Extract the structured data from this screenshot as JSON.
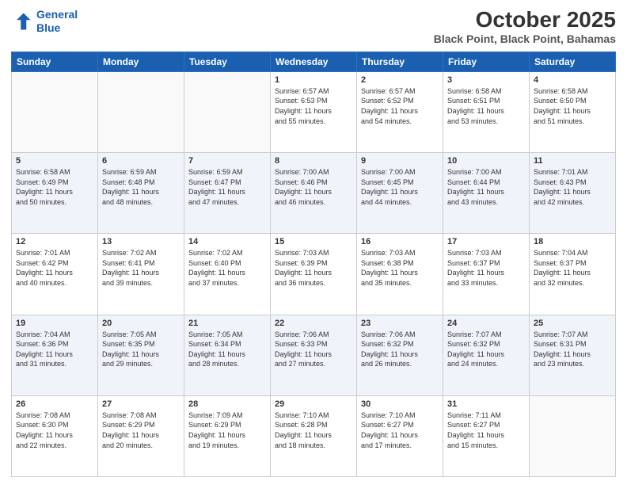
{
  "header": {
    "logo_line1": "General",
    "logo_line2": "Blue",
    "month": "October 2025",
    "location": "Black Point, Black Point, Bahamas"
  },
  "days_of_week": [
    "Sunday",
    "Monday",
    "Tuesday",
    "Wednesday",
    "Thursday",
    "Friday",
    "Saturday"
  ],
  "weeks": [
    [
      {
        "day": "",
        "info": ""
      },
      {
        "day": "",
        "info": ""
      },
      {
        "day": "",
        "info": ""
      },
      {
        "day": "1",
        "info": "Sunrise: 6:57 AM\nSunset: 6:53 PM\nDaylight: 11 hours\nand 55 minutes."
      },
      {
        "day": "2",
        "info": "Sunrise: 6:57 AM\nSunset: 6:52 PM\nDaylight: 11 hours\nand 54 minutes."
      },
      {
        "day": "3",
        "info": "Sunrise: 6:58 AM\nSunset: 6:51 PM\nDaylight: 11 hours\nand 53 minutes."
      },
      {
        "day": "4",
        "info": "Sunrise: 6:58 AM\nSunset: 6:50 PM\nDaylight: 11 hours\nand 51 minutes."
      }
    ],
    [
      {
        "day": "5",
        "info": "Sunrise: 6:58 AM\nSunset: 6:49 PM\nDaylight: 11 hours\nand 50 minutes."
      },
      {
        "day": "6",
        "info": "Sunrise: 6:59 AM\nSunset: 6:48 PM\nDaylight: 11 hours\nand 48 minutes."
      },
      {
        "day": "7",
        "info": "Sunrise: 6:59 AM\nSunset: 6:47 PM\nDaylight: 11 hours\nand 47 minutes."
      },
      {
        "day": "8",
        "info": "Sunrise: 7:00 AM\nSunset: 6:46 PM\nDaylight: 11 hours\nand 46 minutes."
      },
      {
        "day": "9",
        "info": "Sunrise: 7:00 AM\nSunset: 6:45 PM\nDaylight: 11 hours\nand 44 minutes."
      },
      {
        "day": "10",
        "info": "Sunrise: 7:00 AM\nSunset: 6:44 PM\nDaylight: 11 hours\nand 43 minutes."
      },
      {
        "day": "11",
        "info": "Sunrise: 7:01 AM\nSunset: 6:43 PM\nDaylight: 11 hours\nand 42 minutes."
      }
    ],
    [
      {
        "day": "12",
        "info": "Sunrise: 7:01 AM\nSunset: 6:42 PM\nDaylight: 11 hours\nand 40 minutes."
      },
      {
        "day": "13",
        "info": "Sunrise: 7:02 AM\nSunset: 6:41 PM\nDaylight: 11 hours\nand 39 minutes."
      },
      {
        "day": "14",
        "info": "Sunrise: 7:02 AM\nSunset: 6:40 PM\nDaylight: 11 hours\nand 37 minutes."
      },
      {
        "day": "15",
        "info": "Sunrise: 7:03 AM\nSunset: 6:39 PM\nDaylight: 11 hours\nand 36 minutes."
      },
      {
        "day": "16",
        "info": "Sunrise: 7:03 AM\nSunset: 6:38 PM\nDaylight: 11 hours\nand 35 minutes."
      },
      {
        "day": "17",
        "info": "Sunrise: 7:03 AM\nSunset: 6:37 PM\nDaylight: 11 hours\nand 33 minutes."
      },
      {
        "day": "18",
        "info": "Sunrise: 7:04 AM\nSunset: 6:37 PM\nDaylight: 11 hours\nand 32 minutes."
      }
    ],
    [
      {
        "day": "19",
        "info": "Sunrise: 7:04 AM\nSunset: 6:36 PM\nDaylight: 11 hours\nand 31 minutes."
      },
      {
        "day": "20",
        "info": "Sunrise: 7:05 AM\nSunset: 6:35 PM\nDaylight: 11 hours\nand 29 minutes."
      },
      {
        "day": "21",
        "info": "Sunrise: 7:05 AM\nSunset: 6:34 PM\nDaylight: 11 hours\nand 28 minutes."
      },
      {
        "day": "22",
        "info": "Sunrise: 7:06 AM\nSunset: 6:33 PM\nDaylight: 11 hours\nand 27 minutes."
      },
      {
        "day": "23",
        "info": "Sunrise: 7:06 AM\nSunset: 6:32 PM\nDaylight: 11 hours\nand 26 minutes."
      },
      {
        "day": "24",
        "info": "Sunrise: 7:07 AM\nSunset: 6:32 PM\nDaylight: 11 hours\nand 24 minutes."
      },
      {
        "day": "25",
        "info": "Sunrise: 7:07 AM\nSunset: 6:31 PM\nDaylight: 11 hours\nand 23 minutes."
      }
    ],
    [
      {
        "day": "26",
        "info": "Sunrise: 7:08 AM\nSunset: 6:30 PM\nDaylight: 11 hours\nand 22 minutes."
      },
      {
        "day": "27",
        "info": "Sunrise: 7:08 AM\nSunset: 6:29 PM\nDaylight: 11 hours\nand 20 minutes."
      },
      {
        "day": "28",
        "info": "Sunrise: 7:09 AM\nSunset: 6:29 PM\nDaylight: 11 hours\nand 19 minutes."
      },
      {
        "day": "29",
        "info": "Sunrise: 7:10 AM\nSunset: 6:28 PM\nDaylight: 11 hours\nand 18 minutes."
      },
      {
        "day": "30",
        "info": "Sunrise: 7:10 AM\nSunset: 6:27 PM\nDaylight: 11 hours\nand 17 minutes."
      },
      {
        "day": "31",
        "info": "Sunrise: 7:11 AM\nSunset: 6:27 PM\nDaylight: 11 hours\nand 15 minutes."
      },
      {
        "day": "",
        "info": ""
      }
    ]
  ]
}
